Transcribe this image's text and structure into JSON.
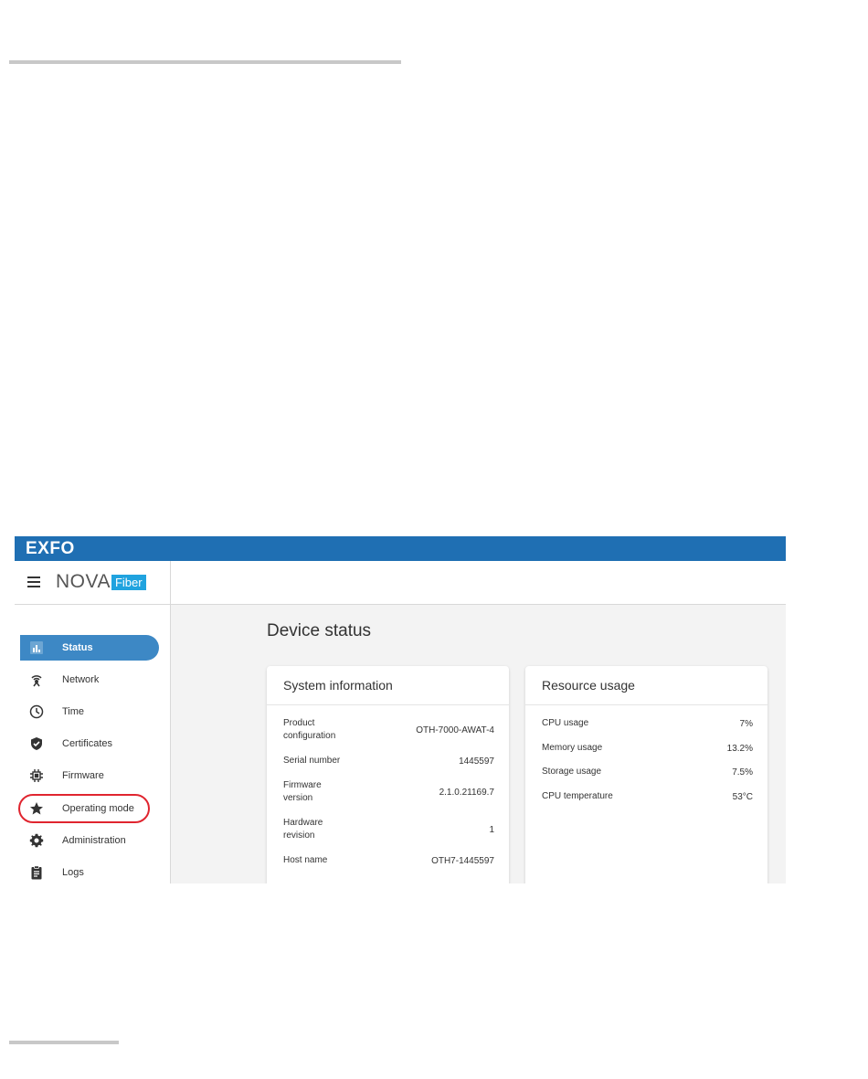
{
  "brand": {
    "company": "EXFO",
    "product": "NOVA",
    "product_badge": "Fiber"
  },
  "sidebar": {
    "items": [
      {
        "label": "Status",
        "icon": "bar-chart-icon",
        "active": true
      },
      {
        "label": "Network",
        "icon": "antenna-icon"
      },
      {
        "label": "Time",
        "icon": "clock-icon"
      },
      {
        "label": "Certificates",
        "icon": "shield-check-icon"
      },
      {
        "label": "Firmware",
        "icon": "chip-icon"
      },
      {
        "label": "Operating mode",
        "icon": "star-icon",
        "highlighted": true
      },
      {
        "label": "Administration",
        "icon": "gear-icon"
      },
      {
        "label": "Logs",
        "icon": "clipboard-icon"
      }
    ]
  },
  "main": {
    "page_title": "Device status",
    "system_info": {
      "title": "System information",
      "rows": [
        {
          "label": "Product configuration",
          "value": "OTH-7000-AWAT-4"
        },
        {
          "label": "Serial number",
          "value": "1445597"
        },
        {
          "label": "Firmware version",
          "value": "2.1.0.21169.7"
        },
        {
          "label": "Hardware revision",
          "value": "1"
        },
        {
          "label": "Host name",
          "value": "OTH7-1445597"
        }
      ]
    },
    "resource_usage": {
      "title": "Resource usage",
      "rows": [
        {
          "label": "CPU usage",
          "value": "7%"
        },
        {
          "label": "Memory usage",
          "value": "13.2%"
        },
        {
          "label": "Storage usage",
          "value": "7.5%"
        },
        {
          "label": "CPU temperature",
          "value": "53°C"
        }
      ]
    }
  },
  "colors": {
    "brand_bar": "#1f6fb3",
    "active_nav": "#3d88c5",
    "badge": "#20a3df",
    "highlight_ring": "#e0252f"
  }
}
